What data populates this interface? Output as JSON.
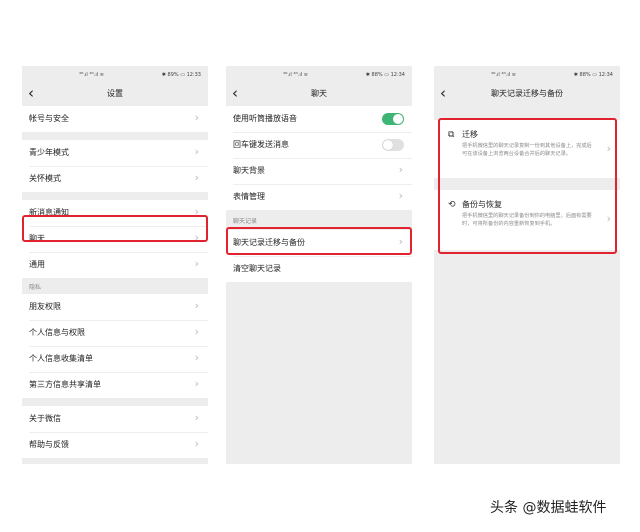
{
  "phone1": {
    "status_signal": "⁴ᴳ.ıl ⁴ᴳ.ıl ≋",
    "status_right": "✱ 89% ▭ 12:33",
    "title": "设置",
    "items_top": [
      "帐号与安全"
    ],
    "items_mid": [
      "青少年模式",
      "关怀模式"
    ],
    "items_chat": [
      "新消息通知",
      "聊天",
      "通用"
    ],
    "section_privacy": "隐私",
    "items_privacy": [
      "朋友权限",
      "个人信息与权限",
      "个人信息收集清单",
      "第三方信息共享清单"
    ],
    "items_about": [
      "关于微信",
      "帮助与反馈"
    ],
    "items_bottom": [
      "插件"
    ]
  },
  "phone2": {
    "status_signal": "⁴ᴳ.ıl ⁴ᴳ.ıl ≋",
    "status_right": "✱ 88% ▭ 12:34",
    "title": "聊天",
    "toggle_items": [
      {
        "label": "使用听筒播放语音",
        "on": true
      },
      {
        "label": "回车键发送消息",
        "on": false
      }
    ],
    "items": [
      "聊天背景",
      "表情管理"
    ],
    "section_records": "聊天记录",
    "items_records": [
      "聊天记录迁移与备份",
      "清空聊天记录"
    ]
  },
  "phone3": {
    "status_signal": "⁴ᴳ.ıl ⁴ᴳ.ıl ≋",
    "status_right": "✱ 88% ▭ 12:34",
    "title": "聊天记录迁移与备份",
    "cards": [
      {
        "icon": "migrate-icon",
        "title": "迁移",
        "desc": "把手机微信里的聊天记录复制一份到其他设备上，完成后可在该设备上浏览两台设备合并后的聊天记录。"
      },
      {
        "icon": "backup-restore-icon",
        "title": "备份与恢复",
        "desc": "把手机微信里的聊天记录备份到你的电脑里。后面有需要时，可将所备份的内容重新恢复到手机。"
      }
    ]
  },
  "colors": {
    "highlight": "#e0232f",
    "toggle_on": "#3eb575"
  },
  "watermark": "头条 @数据蛙软件"
}
